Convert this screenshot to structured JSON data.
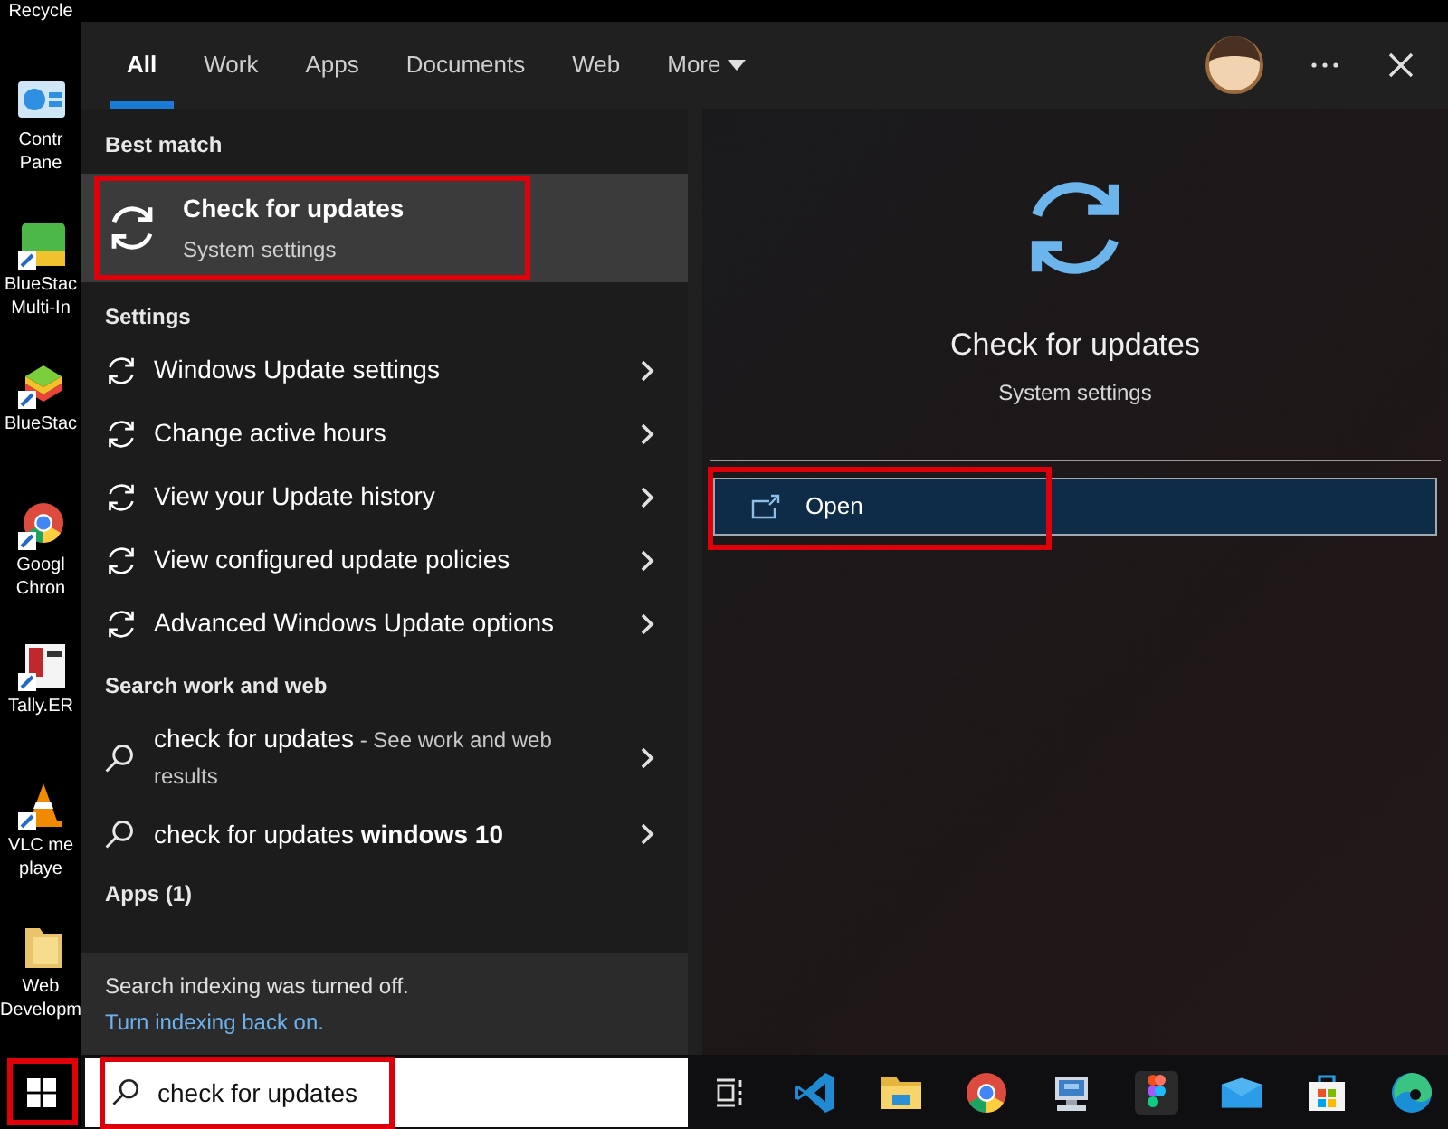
{
  "desktop_icons": [
    {
      "lines": [
        "Recycle"
      ]
    },
    {
      "lines": [
        "Contr",
        "Pane"
      ]
    },
    {
      "lines": [
        "BlueStac",
        "Multi-In"
      ]
    },
    {
      "lines": [
        "BlueStac"
      ]
    },
    {
      "lines": [
        "Googl",
        "Chron"
      ]
    },
    {
      "lines": [
        "Tally.ER"
      ]
    },
    {
      "lines": [
        "VLC me",
        "playe"
      ]
    },
    {
      "lines": [
        "Web",
        "Developm"
      ]
    }
  ],
  "tabs": [
    {
      "label": "All",
      "selected": true,
      "kind": "plain"
    },
    {
      "label": "Work",
      "selected": false,
      "kind": "plain"
    },
    {
      "label": "Apps",
      "selected": false,
      "kind": "plain"
    },
    {
      "label": "Documents",
      "selected": false,
      "kind": "plain"
    },
    {
      "label": "Web",
      "selected": false,
      "kind": "plain"
    },
    {
      "label": "More",
      "selected": false,
      "kind": "dropdown"
    }
  ],
  "best_match": {
    "heading": "Best match",
    "title": "Check for updates",
    "subtitle": "System settings",
    "selected": true,
    "highlighted": true
  },
  "settings": {
    "heading": "Settings",
    "items": [
      {
        "label": "Windows Update settings"
      },
      {
        "label": "Change active hours"
      },
      {
        "label": "View your Update history"
      },
      {
        "label": "View configured update policies"
      },
      {
        "label": "Advanced Windows Update options"
      }
    ]
  },
  "web": {
    "heading": "Search work and web",
    "items": [
      {
        "text": "check for updates",
        "note": "- See work and web results"
      },
      {
        "text": "check for updates **windows 10**"
      }
    ]
  },
  "apps_heading": "Apps (1)",
  "notice": {
    "text": "Search indexing was turned off.",
    "link": "Turn indexing back on."
  },
  "preview": {
    "title": "Check for updates",
    "subtitle": "System settings",
    "action": {
      "label": "Open",
      "highlighted": true
    }
  },
  "taskbar": {
    "start_highlighted": true,
    "search": {
      "value": "check for updates",
      "highlighted": true
    }
  }
}
